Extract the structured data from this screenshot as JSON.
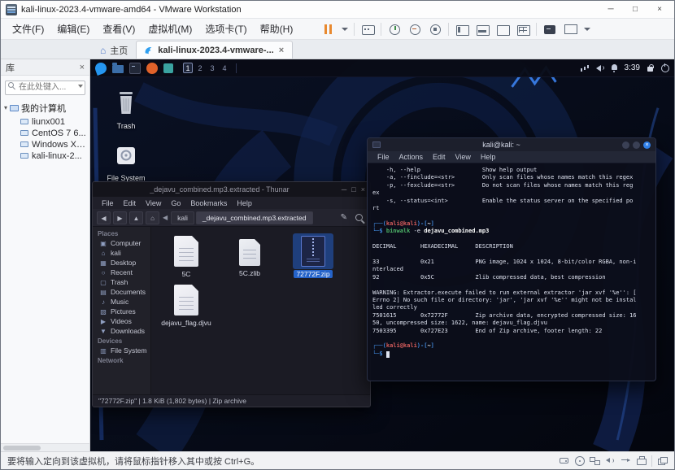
{
  "window": {
    "title": "kali-linux-2023.4-vmware-amd64 - VMware Workstation",
    "controls": {
      "minimize": "─",
      "maximize": "□",
      "close": "×"
    }
  },
  "menubar": {
    "items": [
      "文件(F)",
      "编辑(E)",
      "查看(V)",
      "虚拟机(M)",
      "选项卡(T)",
      "帮助(H)"
    ]
  },
  "toolbar": {
    "items": [
      {
        "name": "suspend-button",
        "kind": "pause"
      },
      {
        "name": "suspend-caret",
        "kind": "caret"
      },
      {
        "name": "toolbar-divider",
        "kind": "div"
      },
      {
        "name": "ctrl-alt-del-button",
        "kind": "key"
      },
      {
        "name": "toolbar-divider",
        "kind": "div"
      },
      {
        "name": "take-snapshot-button",
        "kind": "snap"
      },
      {
        "name": "revert-snapshot-button",
        "kind": "snap2"
      },
      {
        "name": "snapshot-manager-button",
        "kind": "snapmgr"
      },
      {
        "name": "toolbar-divider",
        "kind": "div"
      },
      {
        "name": "show-library-button",
        "kind": "pane-left"
      },
      {
        "name": "show-thumbnails-button",
        "kind": "pane-bottom"
      },
      {
        "name": "fullscreen-button",
        "kind": "pane-full"
      },
      {
        "name": "unity-button",
        "kind": "pane-grid"
      },
      {
        "name": "toolbar-divider",
        "kind": "div"
      },
      {
        "name": "console-view-button",
        "kind": "console"
      },
      {
        "name": "display-settings-button",
        "kind": "display"
      },
      {
        "name": "display-caret",
        "kind": "caret"
      }
    ]
  },
  "tabbar": {
    "home_icon": "⌂",
    "home_label": "主页",
    "vm_label": "kali-linux-2023.4-vmware-...",
    "close_glyph": "×"
  },
  "library": {
    "title": "库",
    "close_glyph": "×",
    "search_placeholder": "在此处键入...",
    "expander": "▾",
    "root": "我的计算机",
    "vms": [
      "liunx001",
      "CentOS 7 6...",
      "Windows XP...",
      "kali-linux-2..."
    ]
  },
  "vm": {
    "panel": {
      "app_icons": [
        "kali-menu",
        "file-manager",
        "terminal",
        "browser",
        "editor"
      ],
      "workspaces": [
        "1",
        "2",
        "3",
        "4"
      ],
      "tray": [
        "network",
        "volume",
        "bell"
      ],
      "clock": "3:39",
      "right_icons": [
        "lock",
        "power"
      ]
    },
    "desktop_icons": [
      {
        "label": "Trash"
      },
      {
        "label": "File System"
      }
    ]
  },
  "thunar": {
    "title": "_dejavu_combined.mp3.extracted - Thunar",
    "controls": {
      "minimize": "─",
      "maximize": "□",
      "close": "×"
    },
    "menus": [
      "File",
      "Edit",
      "View",
      "Go",
      "Bookmarks",
      "Help"
    ],
    "nav": [
      {
        "n": "back",
        "g": "◀"
      },
      {
        "n": "forward",
        "g": "▶"
      },
      {
        "n": "up",
        "g": "▲"
      },
      {
        "n": "home",
        "g": "⌂"
      }
    ],
    "path_scroll_glyph": "◀",
    "edit_glyph": "✎",
    "path_segments": [
      "kali",
      "_dejavu_combined.mp3.extracted"
    ],
    "sidebar": [
      {
        "header": "Places"
      },
      {
        "g": "▣",
        "label": "Computer"
      },
      {
        "g": "⌂",
        "label": "kali"
      },
      {
        "g": "▦",
        "label": "Desktop"
      },
      {
        "g": "○",
        "label": "Recent"
      },
      {
        "g": "▢",
        "label": "Trash"
      },
      {
        "g": "▤",
        "label": "Documents"
      },
      {
        "g": "♪",
        "label": "Music"
      },
      {
        "g": "▧",
        "label": "Pictures"
      },
      {
        "g": "▶",
        "label": "Videos"
      },
      {
        "g": "▼",
        "label": "Downloads"
      },
      {
        "header": "Devices"
      },
      {
        "g": "▥",
        "label": "File System"
      },
      {
        "header": "Network"
      }
    ],
    "files": [
      {
        "name": "5C",
        "type": "doc",
        "selected": false
      },
      {
        "name": "5C.zlib",
        "type": "doc2",
        "selected": false
      },
      {
        "name": "72772F.zip",
        "type": "zip",
        "selected": true
      },
      {
        "name": "dejavu_flag.djvu",
        "type": "doc",
        "selected": false
      }
    ],
    "status": "\"72772F.zip\" | 1.8 KiB (1,802 bytes) | Zip archive"
  },
  "terminal": {
    "title": "kali@kali: ~",
    "menus": [
      "File",
      "Actions",
      "Edit",
      "View",
      "Help"
    ],
    "lines": [
      {
        "text": "    -h, --help                  Show help output"
      },
      {
        "text": "    -a, --finclude=<str>        Only scan files whose names match this regex"
      },
      {
        "text": "    -p, --fexclude=<str>        Do not scan files whose names match this reg"
      },
      {
        "text": "ex"
      },
      {
        "text": "    -s, --status=<int>          Enable the status server on the specified po"
      },
      {
        "text": "rt"
      },
      {
        "text": ""
      },
      {
        "segments": [
          {
            "t": "┌──(",
            "c": "frame"
          },
          {
            "t": "kali@kali",
            "c": "user"
          },
          {
            "t": ")-[",
            "c": "frame"
          },
          {
            "t": "~",
            "c": "path"
          },
          {
            "t": "]",
            "c": "frame"
          }
        ]
      },
      {
        "segments": [
          {
            "t": "└─$ ",
            "c": "frame"
          },
          {
            "t": "binwalk",
            "c": "cmd"
          },
          {
            "t": " -e ",
            "c": "plain"
          },
          {
            "t": "dejavu_combined.mp3",
            "c": "arg"
          }
        ]
      },
      {
        "text": ""
      },
      {
        "text": "DECIMAL       HEXADECIMAL     DESCRIPTION"
      },
      {
        "text": ""
      },
      {
        "text": "33            0x21            PNG image, 1024 x 1024, 8-bit/color RGBA, non-i"
      },
      {
        "text": "nterlaced"
      },
      {
        "text": "92            0x5C            Zlib compressed data, best compression"
      },
      {
        "text": ""
      },
      {
        "text": "WARNING: Extractor.execute failed to run external extractor 'jar xvf '%e'': ["
      },
      {
        "text": "Errno 2] No such file or directory: 'jar', 'jar xvf '%e'' might not be instal"
      },
      {
        "text": "led correctly"
      },
      {
        "text": "7501615       0x72772F        Zip archive data, encrypted compressed size: 16"
      },
      {
        "text": "50, uncompressed size: 1622, name: dejavu_flag.djvu"
      },
      {
        "text": "7503395       0x727E23        End of Zip archive, footer length: 22"
      },
      {
        "text": ""
      },
      {
        "segments": [
          {
            "t": "┌──(",
            "c": "frame"
          },
          {
            "t": "kali@kali",
            "c": "user"
          },
          {
            "t": ")-[",
            "c": "frame"
          },
          {
            "t": "~",
            "c": "path"
          },
          {
            "t": "]",
            "c": "frame"
          }
        ]
      },
      {
        "segments": [
          {
            "t": "└─$ ",
            "c": "frame"
          },
          {
            "t": " ",
            "c": "cursor"
          }
        ]
      }
    ]
  },
  "statusbar": {
    "message": "要将输入定向到该虚拟机，请将鼠标指针移入其中或按 Ctrl+G。",
    "device_icons": [
      "hdd",
      "cd",
      "net",
      "snd",
      "usb",
      "prn"
    ]
  }
}
